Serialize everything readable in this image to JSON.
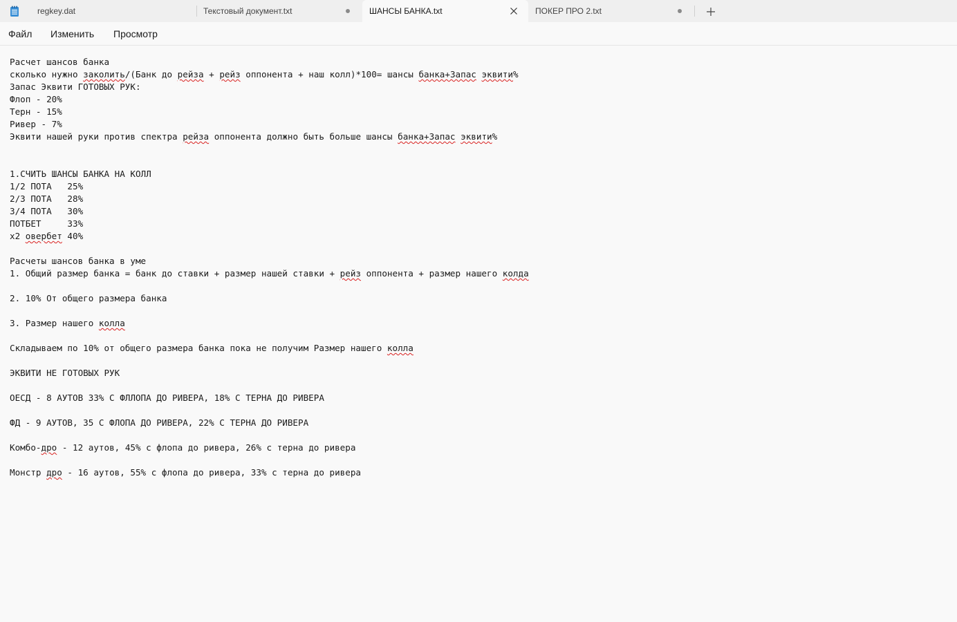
{
  "tabs": [
    {
      "label": "regkey.dat",
      "state": "inactive"
    },
    {
      "label": "Текстовый документ.txt",
      "state": "modified"
    },
    {
      "label": "ШАНСЫ БАНКА.txt",
      "state": "active"
    },
    {
      "label": "ПОКЕР ПРО 2.txt",
      "state": "modified"
    }
  ],
  "icons": {
    "app": "notepad-icon",
    "modified": "unsaved-dot-icon",
    "close": "close-icon",
    "new_tab": "plus-icon"
  },
  "menu": {
    "file": "Файл",
    "edit": "Изменить",
    "view": "Просмотр"
  },
  "colors": {
    "spellcheck": "#d9201f",
    "background": "#f9f9f9",
    "titlebar": "#efefef"
  },
  "document": {
    "lines": [
      [
        {
          "t": "Расчет шансов банка"
        }
      ],
      [
        {
          "t": "сколько нужно "
        },
        {
          "t": "заколить",
          "sq": true
        },
        {
          "t": "/(Банк до "
        },
        {
          "t": "рейза",
          "sq": true
        },
        {
          "t": " + "
        },
        {
          "t": "рейз",
          "sq": true
        },
        {
          "t": " оппонента + наш колл)*100= шансы "
        },
        {
          "t": "банка+Запас",
          "sq": true
        },
        {
          "t": " "
        },
        {
          "t": "эквити",
          "sq": true
        },
        {
          "t": "%"
        }
      ],
      [
        {
          "t": "Запас Эквити ГОТОВЫХ РУК:"
        }
      ],
      [
        {
          "t": "Флоп - 20%"
        }
      ],
      [
        {
          "t": "Терн - 15%"
        }
      ],
      [
        {
          "t": "Ривер - 7%"
        }
      ],
      [
        {
          "t": "Эквити нашей руки против спектра "
        },
        {
          "t": "рейза",
          "sq": true
        },
        {
          "t": " оппонента должно быть больше шансы "
        },
        {
          "t": "банка+Запас",
          "sq": true
        },
        {
          "t": " "
        },
        {
          "t": "эквити",
          "sq": true
        },
        {
          "t": "%"
        }
      ],
      [],
      [],
      [
        {
          "t": "1.СЧИТЬ ШАНСЫ БАНКА НА КОЛЛ"
        }
      ],
      [
        {
          "t": "1/2 ПОТА   25%"
        }
      ],
      [
        {
          "t": "2/3 ПОТА   28%"
        }
      ],
      [
        {
          "t": "3/4 ПОТА   30%"
        }
      ],
      [
        {
          "t": "ПОТБЕТ     33%"
        }
      ],
      [
        {
          "t": "x2 "
        },
        {
          "t": "овербет",
          "sq": true
        },
        {
          "t": " 40%"
        }
      ],
      [],
      [
        {
          "t": "Расчеты шансов банка в уме"
        }
      ],
      [
        {
          "t": "1. Общий размер банка = банк до ставки + размер нашей ставки + "
        },
        {
          "t": "рейз",
          "sq": true
        },
        {
          "t": " оппонента + размер нашего "
        },
        {
          "t": "колда",
          "sq": true
        }
      ],
      [],
      [
        {
          "t": "2. 10% От общего размера банка"
        }
      ],
      [],
      [
        {
          "t": "3. Размер нашего "
        },
        {
          "t": "колла",
          "sq": true
        }
      ],
      [],
      [
        {
          "t": "Складываем по 10% от общего размера банка пока не получим Размер нашего "
        },
        {
          "t": "колла",
          "sq": true
        }
      ],
      [],
      [
        {
          "t": "ЭКВИТИ НЕ ГОТОВЫХ РУК"
        }
      ],
      [],
      [
        {
          "t": "ОЕСД - 8 АУТОВ 33% С ФЛЛОПА ДО РИВЕРА, 18% С ТЕРНА ДО РИВЕРА"
        }
      ],
      [],
      [
        {
          "t": "ФД - 9 АУТОВ, 35 С ФЛОПА ДО РИВЕРА, 22% С ТЕРНА ДО РИВЕРА"
        }
      ],
      [],
      [
        {
          "t": "Комбо-"
        },
        {
          "t": "дро",
          "sq": true
        },
        {
          "t": " - 12 аутов, 45% с флопа до ривера, 26% с терна до ривера"
        }
      ],
      [],
      [
        {
          "t": "Монстр "
        },
        {
          "t": "дро",
          "sq": true
        },
        {
          "t": " - 16 аутов, 55% с флопа до ривера, 33% с терна до ривера"
        }
      ]
    ]
  }
}
